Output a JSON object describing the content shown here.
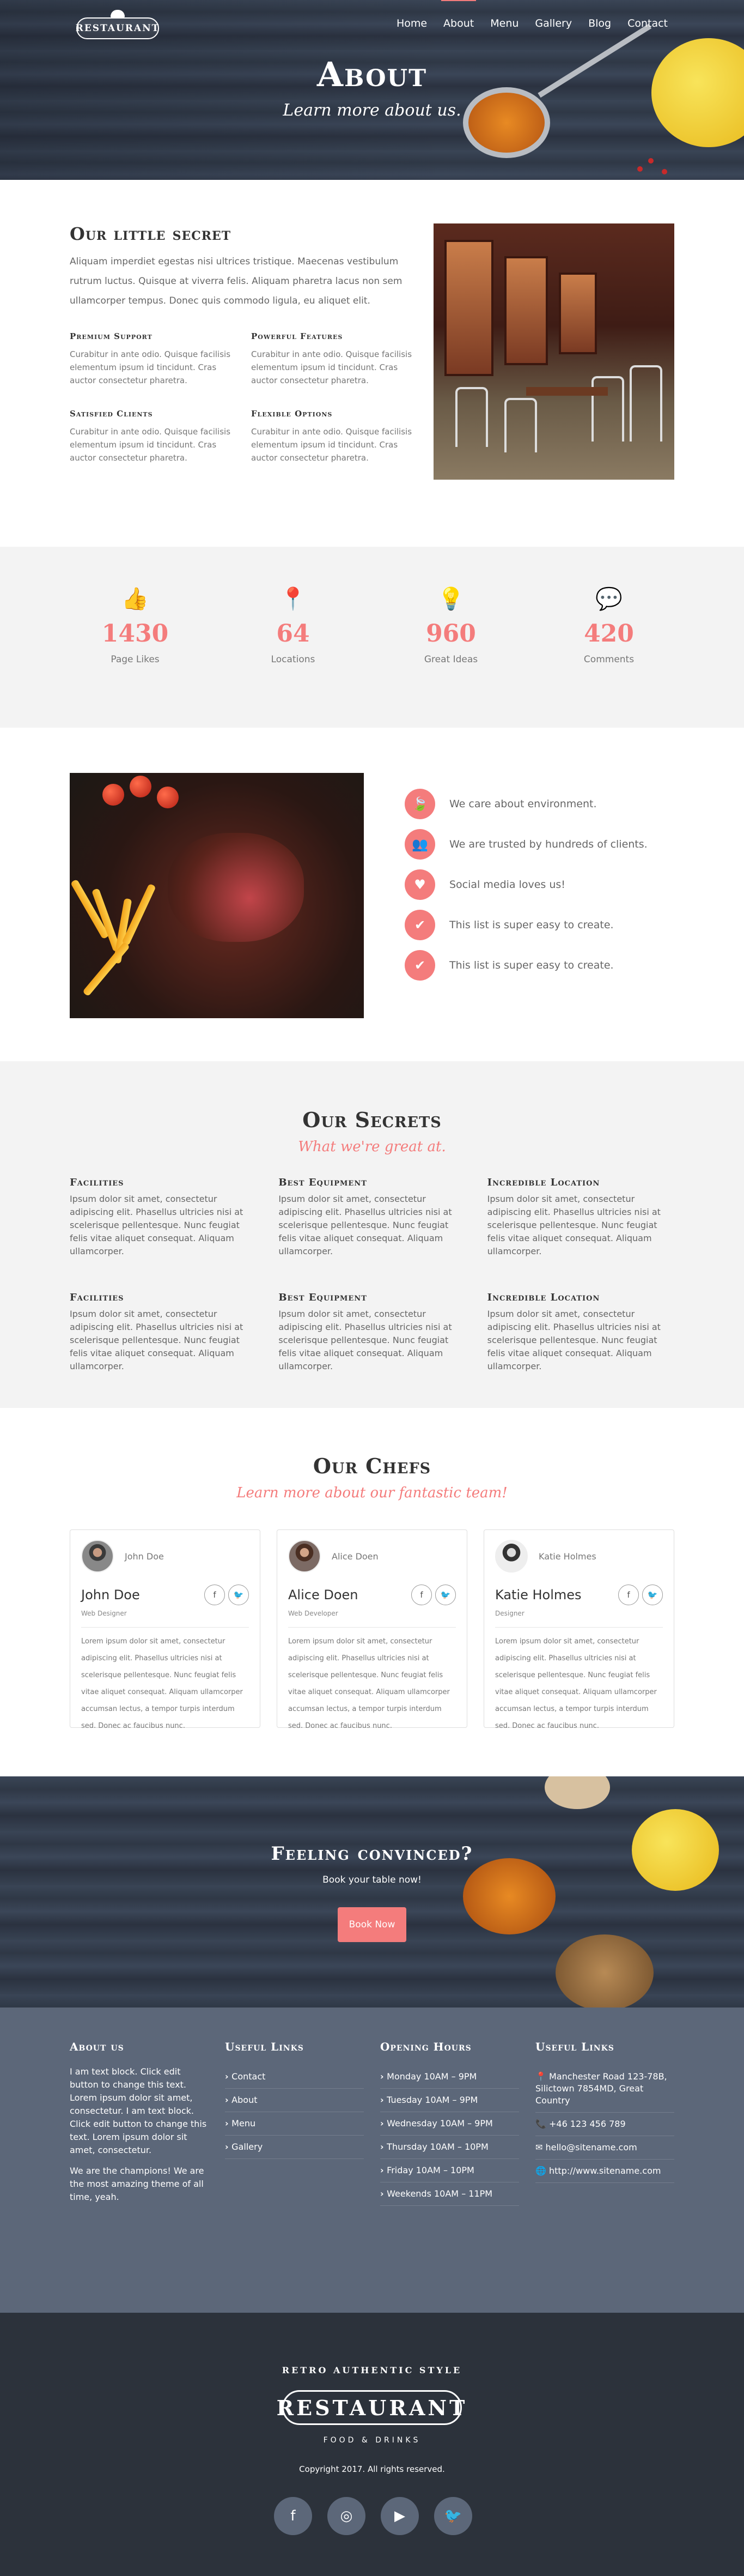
{
  "nav": {
    "logo": "RESTAURANT",
    "items": [
      "Home",
      "About",
      "Menu",
      "Gallery",
      "Blog",
      "Contact"
    ],
    "active": "About"
  },
  "hero": {
    "title": "About",
    "subtitle": "Learn more about us."
  },
  "secret": {
    "title": "Our little secret",
    "lead": "Aliquam imperdiet egestas nisi ultrices tristique. Maecenas vestibulum rutrum luctus. Quisque at viverra felis. Aliquam pharetra lacus non sem ullamcorper tempus. Donec quis commodo ligula, eu aliquet elit.",
    "features": [
      {
        "title": "Premium Support",
        "text": "Curabitur in ante odio. Quisque facilisis elementum ipsum id tincidunt. Cras auctor consectetur pharetra."
      },
      {
        "title": "Powerful Features",
        "text": "Curabitur in ante odio. Quisque facilisis elementum ipsum id tincidunt. Cras auctor consectetur pharetra."
      },
      {
        "title": "Satisfied Clients",
        "text": "Curabitur in ante odio. Quisque facilisis elementum ipsum id tincidunt. Cras auctor consectetur pharetra."
      },
      {
        "title": "Flexible Options",
        "text": "Curabitur in ante odio. Quisque facilisis elementum ipsum id tincidunt. Cras auctor consectetur pharetra."
      }
    ]
  },
  "stats": [
    {
      "icon": "thumbs-up-icon",
      "glyph": "👍",
      "value": "1430",
      "label": "Page Likes"
    },
    {
      "icon": "map-pin-icon",
      "glyph": "📍",
      "value": "64",
      "label": "Locations"
    },
    {
      "icon": "lightbulb-icon",
      "glyph": "💡",
      "value": "960",
      "label": "Great Ideas"
    },
    {
      "icon": "comments-icon",
      "glyph": "💬",
      "value": "420",
      "label": "Comments"
    }
  ],
  "values": [
    {
      "icon": "leaf-icon",
      "glyph": "🍃",
      "text": "We care about environment."
    },
    {
      "icon": "users-icon",
      "glyph": "👥",
      "text": "We are trusted by hundreds of clients."
    },
    {
      "icon": "heart-icon",
      "glyph": "♥",
      "text": "Social media loves us!"
    },
    {
      "icon": "check-icon",
      "glyph": "✔",
      "text": "This list is super easy to create."
    },
    {
      "icon": "check-icon",
      "glyph": "✔",
      "text": "This list is super easy to create."
    }
  ],
  "our_secrets": {
    "title": "Our Secrets",
    "subtitle": "What we're great at.",
    "items": [
      {
        "title": "Facilities",
        "text": "Ipsum dolor sit amet, consectetur adipiscing elit. Phasellus ultricies nisi at scelerisque pellentesque. Nunc feugiat felis vitae aliquet consequat. Aliquam ullamcorper."
      },
      {
        "title": "Best Equipment",
        "text": "Ipsum dolor sit amet, consectetur adipiscing elit. Phasellus ultricies nisi at scelerisque pellentesque. Nunc feugiat felis vitae aliquet consequat. Aliquam ullamcorper."
      },
      {
        "title": "Incredible Location",
        "text": "Ipsum dolor sit amet, consectetur adipiscing elit. Phasellus ultricies nisi at scelerisque pellentesque. Nunc feugiat felis vitae aliquet consequat. Aliquam ullamcorper."
      },
      {
        "title": "Facilities",
        "text": "Ipsum dolor sit amet, consectetur adipiscing elit. Phasellus ultricies nisi at scelerisque pellentesque. Nunc feugiat felis vitae aliquet consequat. Aliquam ullamcorper."
      },
      {
        "title": "Best Equipment",
        "text": "Ipsum dolor sit amet, consectetur adipiscing elit. Phasellus ultricies nisi at scelerisque pellentesque. Nunc feugiat felis vitae aliquet consequat. Aliquam ullamcorper."
      },
      {
        "title": "Incredible Location",
        "text": "Ipsum dolor sit amet, consectetur adipiscing elit. Phasellus ultricies nisi at scelerisque pellentesque. Nunc feugiat felis vitae aliquet consequat. Aliquam ullamcorper."
      }
    ]
  },
  "chefs": {
    "title": "Our Chefs",
    "subtitle": "Learn more about our fantastic team!",
    "members": [
      {
        "handle": "John Doe",
        "name": "John Doe",
        "role": "Web Designer",
        "bio": "Lorem ipsum dolor sit amet, consectetur adipiscing elit. Phasellus ultricies nisi at scelerisque pellentesque. Nunc feugiat felis vitae aliquet consequat. Aliquam ullamcorper accumsan lectus, a tempor turpis interdum sed. Donec ac faucibus nunc."
      },
      {
        "handle": "Alice Doen",
        "name": "Alice Doen",
        "role": "Web Developer",
        "bio": "Lorem ipsum dolor sit amet, consectetur adipiscing elit. Phasellus ultricies nisi at scelerisque pellentesque. Nunc feugiat felis vitae aliquet consequat. Aliquam ullamcorper accumsan lectus, a tempor turpis interdum sed. Donec ac faucibus nunc."
      },
      {
        "handle": "Katie Holmes",
        "name": "Katie Holmes",
        "role": "Designer",
        "bio": "Lorem ipsum dolor sit amet, consectetur adipiscing elit. Phasellus ultricies nisi at scelerisque pellentesque. Nunc feugiat felis vitae aliquet consequat. Aliquam ullamcorper accumsan lectus, a tempor turpis interdum sed. Donec ac faucibus nunc."
      }
    ],
    "social": {
      "facebook": "f",
      "twitter": "🐦"
    }
  },
  "cta": {
    "title": "Feeling convinced?",
    "text": "Book your table now!",
    "button": "Book Now"
  },
  "footer": {
    "about": {
      "title": "About us",
      "p1": "I am text block. Click edit button to change this text. Lorem ipsum dolor sit amet, consectetur. I am text block. Click edit button to change this text. Lorem ipsum dolor sit amet, consectetur.",
      "p2": "We are the champions! We are the most amazing theme of all time, yeah."
    },
    "links": {
      "title": "Useful Links",
      "items": [
        "Contact",
        "About",
        "Menu",
        "Gallery"
      ]
    },
    "hours": {
      "title": "Opening Hours",
      "items": [
        "Monday 10AM – 9PM",
        "Tuesday 10AM – 9PM",
        "Wednesday 10AM – 9PM",
        "Thursday 10AM – 10PM",
        "Friday 10AM – 10PM",
        "Weekends 10AM – 11PM"
      ]
    },
    "contact": {
      "title": "Useful Links",
      "items": [
        {
          "icon": "map-marker-icon",
          "glyph": "📍",
          "text": "Manchester Road 123-78B, Silictown 7854MD, Great Country"
        },
        {
          "icon": "phone-icon",
          "glyph": "📞",
          "text": "+46 123 456 789"
        },
        {
          "icon": "envelope-icon",
          "glyph": "✉",
          "text": "hello@sitename.com"
        },
        {
          "icon": "globe-icon",
          "glyph": "🌐",
          "text": "http://www.sitename.com"
        }
      ]
    }
  },
  "bottom": {
    "tagline_top": "RETRO AUTHENTIC STYLE",
    "logo": "RESTAURANT",
    "tagline_bottom": "FOOD & DRINKS",
    "copyright": "Copyright 2017. All rights reserved.",
    "social": [
      {
        "icon": "facebook-icon",
        "glyph": "f"
      },
      {
        "icon": "instagram-icon",
        "glyph": "◎"
      },
      {
        "icon": "youtube-icon",
        "glyph": "▶"
      },
      {
        "icon": "twitter-icon",
        "glyph": "🐦"
      }
    ]
  },
  "colors": {
    "accent": "#f47c7c",
    "footer": "#5c6779",
    "bottom": "#2c323b"
  }
}
